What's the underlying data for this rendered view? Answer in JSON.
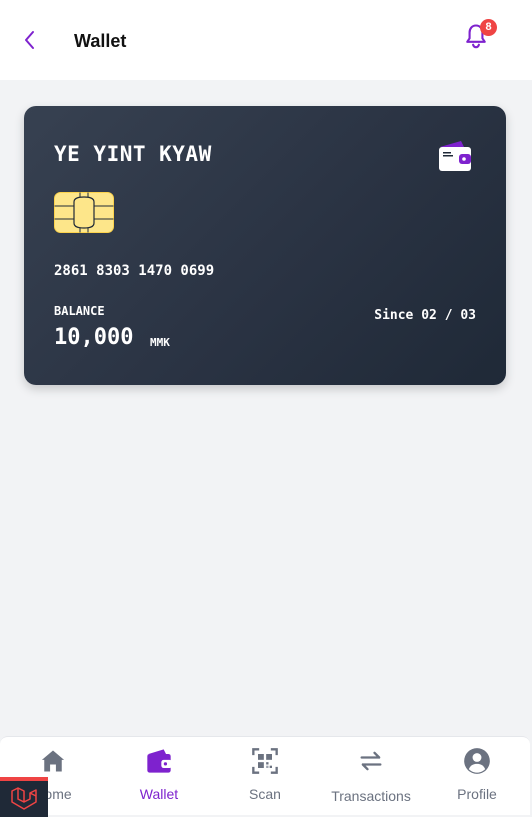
{
  "header": {
    "title": "Wallet",
    "back_icon": "chevron-left-icon",
    "notification_icon": "bell-icon",
    "notification_count": "8"
  },
  "card": {
    "holder_name": "YE YINT KYAW",
    "card_number": "2861 8303 1470 0699",
    "balance_label": "BALANCE",
    "balance_amount": "10,000",
    "currency": "MMK",
    "since": "Since 02 / 03",
    "icon": "wallet-icon",
    "chip_icon": "chip-icon"
  },
  "nav": {
    "items": [
      {
        "label": "Home",
        "icon": "home-icon"
      },
      {
        "label": "Wallet",
        "icon": "wallet-icon",
        "active": true
      },
      {
        "label": "Scan",
        "icon": "qr-scan-icon"
      },
      {
        "label": "Transactions",
        "icon": "arrows-exchange-icon"
      },
      {
        "label": "Profile",
        "icon": "user-circle-icon"
      }
    ]
  },
  "colors": {
    "accent": "#7e22ce",
    "card_dark": "#1f2937",
    "badge": "#ef4444"
  }
}
